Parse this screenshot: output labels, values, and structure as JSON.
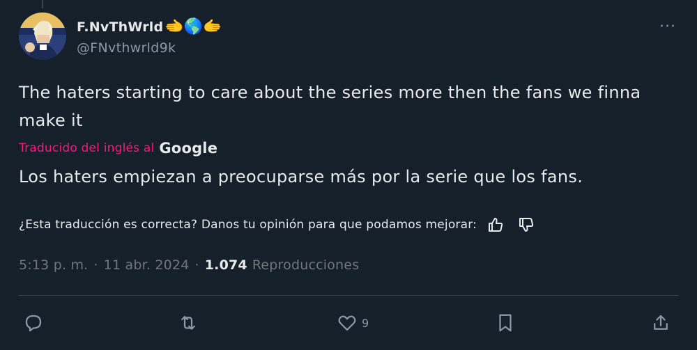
{
  "author": {
    "display_name": "F.NvThWrld",
    "name_emojis": "🫲🌎🫱",
    "handle": "@FNvthwrld9k"
  },
  "more_button": {
    "label": "···"
  },
  "tweet": {
    "text": "The haters starting to care about the series more then the fans we finna make it"
  },
  "translation": {
    "label": "Traducido del inglés al",
    "provider": "Google",
    "text": "Los haters empiezan a preocuparse más por la serie que los fans.",
    "feedback_question": "¿Esta traducción es correcta? Danos tu opinión para que podamos mejorar:"
  },
  "meta": {
    "time": "5:13 p. m.",
    "separator": "·",
    "date": "11 abr. 2024",
    "views_count": "1.074",
    "views_label": "Reproducciones"
  },
  "actions": {
    "reply_count": "",
    "retweet_count": "",
    "like_count": "9",
    "bookmark_count": "",
    "share_count": ""
  },
  "colors": {
    "background": "#15202b",
    "text_primary": "#e7e9ea",
    "text_secondary": "#8b98a5",
    "accent_pink": "#f91880",
    "divider": "#38444d"
  }
}
